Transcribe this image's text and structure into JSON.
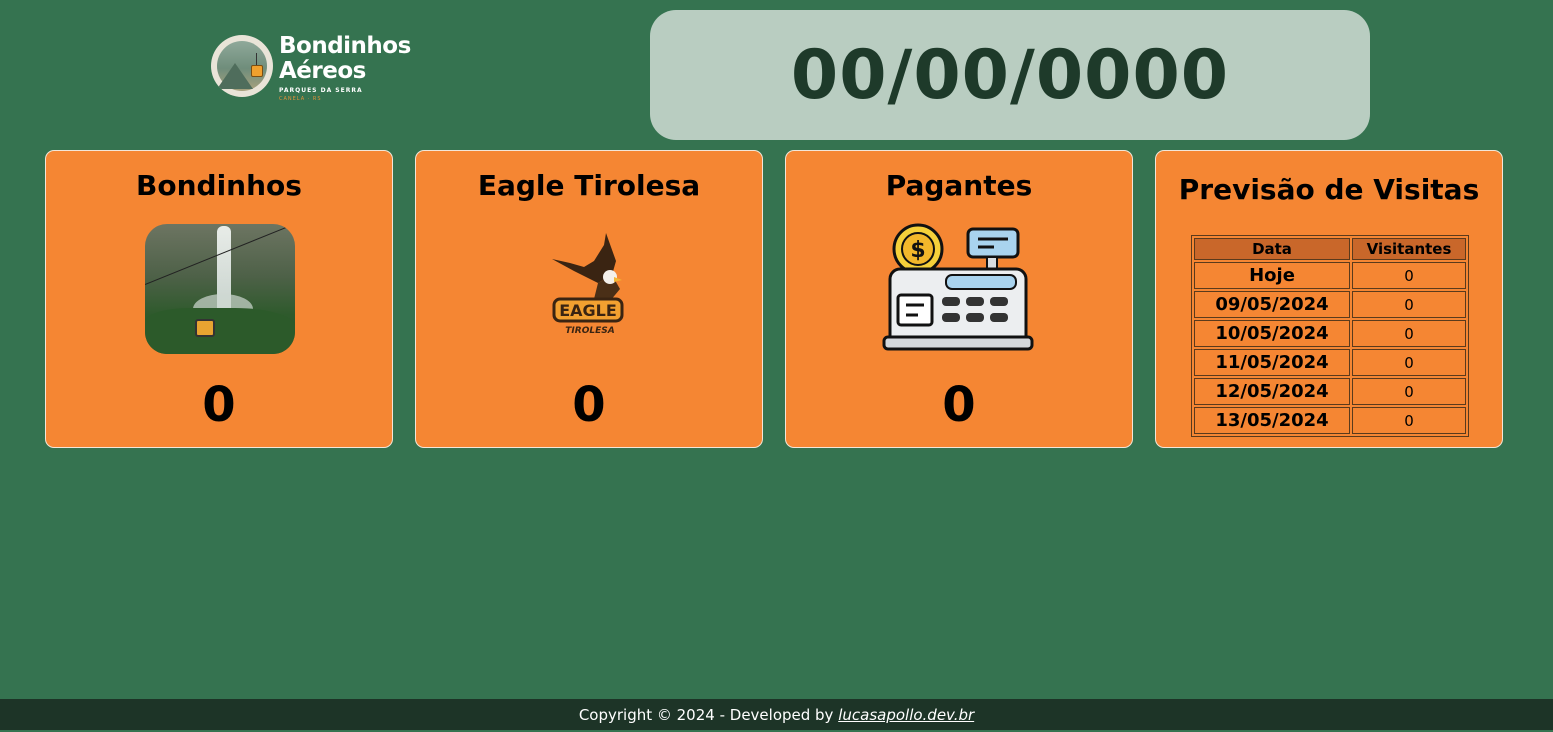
{
  "logo": {
    "line1": "Bondinhos",
    "line2": "Aéreos",
    "line3": "PARQUES DA SERRA",
    "line4": "CANELA · RS"
  },
  "date_display": "00/00/0000",
  "cards": [
    {
      "title": "Bondinhos",
      "value": "0",
      "icon": "cable-car-waterfall-photo"
    },
    {
      "title": "Eagle Tirolesa",
      "value": "0",
      "icon": "eagle-tirolesa-logo"
    },
    {
      "title": "Pagantes",
      "value": "0",
      "icon": "cash-register-icon"
    }
  ],
  "forecast": {
    "title": "Previsão de Visitas",
    "columns": [
      "Data",
      "Visitantes"
    ],
    "rows": [
      {
        "date": "Hoje",
        "visitors": "0"
      },
      {
        "date": "09/05/2024",
        "visitors": "0"
      },
      {
        "date": "10/05/2024",
        "visitors": "0"
      },
      {
        "date": "11/05/2024",
        "visitors": "0"
      },
      {
        "date": "12/05/2024",
        "visitors": "0"
      },
      {
        "date": "13/05/2024",
        "visitors": "0"
      }
    ]
  },
  "footer": {
    "text": "Copyright © 2024 - Developed by ",
    "link": "lucasapollo.dev.br"
  },
  "colors": {
    "background": "#357350",
    "card": "#f58633",
    "date_box": "#b9cdc1",
    "footer": "#1d3427"
  }
}
